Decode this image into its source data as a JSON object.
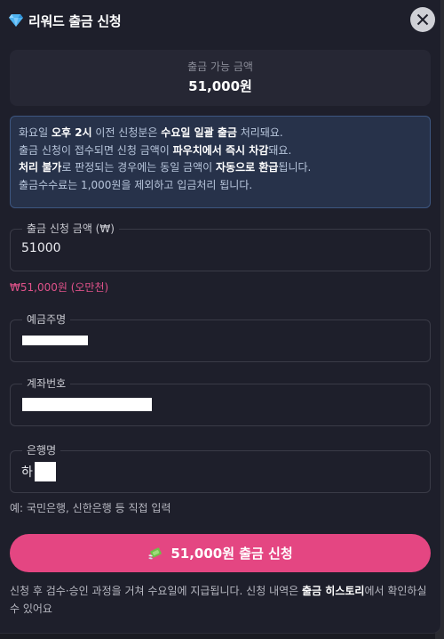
{
  "dialog": {
    "title": "리워드 출금 신청",
    "close_icon": "close-icon",
    "title_icon": "diamond-icon"
  },
  "balance": {
    "label": "출금 가능 금액",
    "value": "51,000원"
  },
  "notice": {
    "line1_a": "화요일 ",
    "line1_b": "오후 2시",
    "line1_c": " 이전 신청분은 ",
    "line1_d": "수요일 일괄 출금",
    "line1_e": " 처리돼요.",
    "line2_a": "출금 신청이 접수되면 신청 금액이 ",
    "line2_b": "파우치에서 즉시 차감",
    "line2_c": "돼요.",
    "line3_a": "처리 불가",
    "line3_b": "로 판정되는 경우에는 동일 금액이 ",
    "line3_c": "자동으로 환급",
    "line3_d": "됩니다.",
    "line4": "출금수수료는 1,000원을 제외하고 입금처리 됩니다."
  },
  "amount_field": {
    "label": "출금 신청 금액 (₩)",
    "value": "51000",
    "hint": "₩51,000원 (오만천)"
  },
  "holder_field": {
    "label": "예금주명",
    "value": ""
  },
  "account_field": {
    "label": "계좌번호",
    "value": ""
  },
  "bank_field": {
    "label": "은행명",
    "value": "하   행",
    "hint": "예: 국민은행, 신한은행 등 직접 입력"
  },
  "submit": {
    "label": "51,000원 출금 신청",
    "icon": "money-with-wings-icon"
  },
  "footer": {
    "part1": "신청 후 검수·승인 과정을 거쳐 수요일에 지급됩니다. 신청 내역은 ",
    "part2": "출금 히스토리",
    "part3": "에서 확인하실 수 있어요"
  },
  "colors": {
    "accent": "#e44682",
    "notice_bg": "#27324a",
    "notice_border": "#3d5680",
    "hint_pink": "#e0528a",
    "modal_bg": "#1e1f2b"
  }
}
